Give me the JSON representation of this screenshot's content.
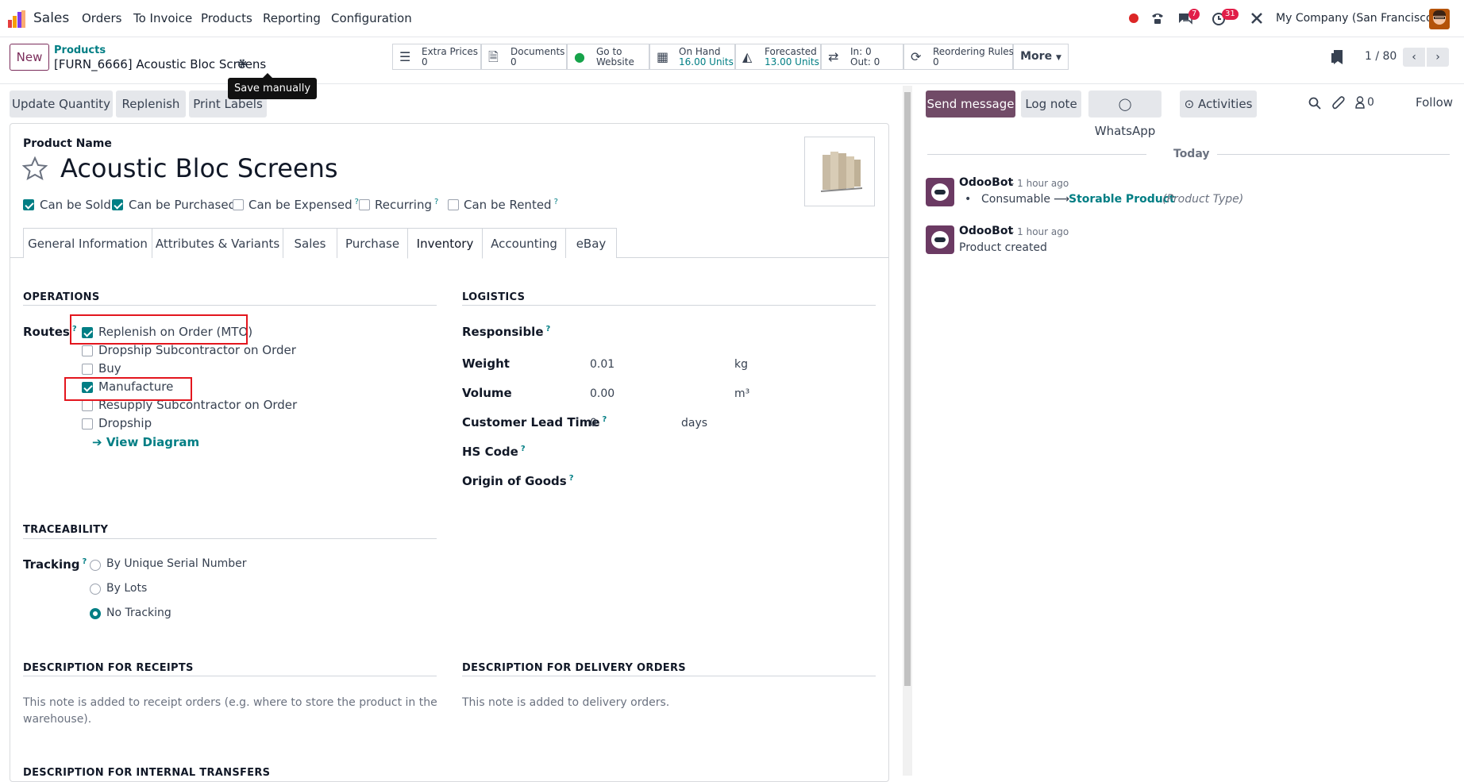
{
  "navbar": {
    "app_name": "Sales",
    "menu": [
      "Orders",
      "To Invoice",
      "Products",
      "Reporting",
      "Configuration"
    ],
    "messages_badge": "7",
    "activities_badge": "31",
    "company": "My Company (San Francisco)"
  },
  "control_panel": {
    "new_label": "New",
    "breadcrumb_parent": "Products",
    "record_title": "[FURN_6666] Acoustic Bloc Screens",
    "tooltip": "Save manually",
    "smart_buttons": {
      "extra_prices": {
        "label": "Extra Prices",
        "value": "0"
      },
      "documents": {
        "label": "Documents",
        "value": "0"
      },
      "website": {
        "label": "Go to",
        "value": "Website"
      },
      "on_hand": {
        "label": "On Hand",
        "value": "16.00 Units"
      },
      "forecasted": {
        "label": "Forecasted",
        "value": "13.00 Units"
      },
      "in_out": {
        "label": "In: 0",
        "value": "Out: 0"
      },
      "reordering": {
        "label": "Reordering Rules",
        "value": "0"
      }
    },
    "more_label": "More",
    "pager": "1 / 80"
  },
  "form_buttons": {
    "update_quantity": "Update Quantity",
    "replenish": "Replenish",
    "print_labels": "Print Labels"
  },
  "product": {
    "name_label": "Product Name",
    "name": "Acoustic Bloc Screens",
    "flags": {
      "can_be_sold": "Can be Sold",
      "can_be_purchased": "Can be Purchased",
      "can_be_expensed": "Can be Expensed",
      "recurring": "Recurring",
      "can_be_rented": "Can be Rented"
    }
  },
  "tabs": [
    "General Information",
    "Attributes & Variants",
    "Sales",
    "Purchase",
    "Inventory",
    "Accounting",
    "eBay"
  ],
  "operations": {
    "title": "OPERATIONS",
    "routes_label": "Routes",
    "routes": [
      {
        "label": "Replenish on Order (MTO)",
        "checked": true
      },
      {
        "label": "Dropship Subcontractor on Order",
        "checked": false
      },
      {
        "label": "Buy",
        "checked": false
      },
      {
        "label": "Manufacture",
        "checked": true
      },
      {
        "label": "Resupply Subcontractor on Order",
        "checked": false
      },
      {
        "label": "Dropship",
        "checked": false
      }
    ],
    "view_diagram": "View Diagram"
  },
  "logistics": {
    "title": "LOGISTICS",
    "responsible_label": "Responsible",
    "weight_label": "Weight",
    "weight": "0.01",
    "weight_unit": "kg",
    "volume_label": "Volume",
    "volume": "0.00",
    "volume_unit": "m³",
    "lead_time_label": "Customer Lead Time",
    "lead_time": "0",
    "lead_time_unit": "days",
    "hs_code_label": "HS Code",
    "origin_label": "Origin of Goods"
  },
  "traceability": {
    "title": "TRACEABILITY",
    "tracking_label": "Tracking",
    "options": [
      "By Unique Serial Number",
      "By Lots",
      "No Tracking"
    ],
    "selected": "No Tracking"
  },
  "descriptions": {
    "receipts_title": "DESCRIPTION FOR RECEIPTS",
    "receipts_text": "This note is added to receipt orders (e.g. where to store the product in the",
    "receipts_text2": "warehouse).",
    "delivery_title": "DESCRIPTION FOR DELIVERY ORDERS",
    "delivery_text": "This note is added to delivery orders.",
    "internal_title": "DESCRIPTION FOR INTERNAL TRANSFERS"
  },
  "chatter": {
    "send_message": "Send message",
    "log_note": "Log note",
    "whatsapp": "WhatsApp",
    "activities": "Activities",
    "followers_count": "0",
    "follow": "Follow",
    "today": "Today",
    "messages": [
      {
        "author": "OdooBot",
        "time": "- 1 hour ago",
        "old": "Consumable",
        "new": "Storable Product",
        "field": "(Product Type)"
      },
      {
        "author": "OdooBot",
        "time": "- 1 hour ago",
        "body": "Product created"
      }
    ]
  },
  "colors": {
    "brand": "#714b67",
    "accent": "#017e84",
    "highlight": "#e3161e"
  }
}
